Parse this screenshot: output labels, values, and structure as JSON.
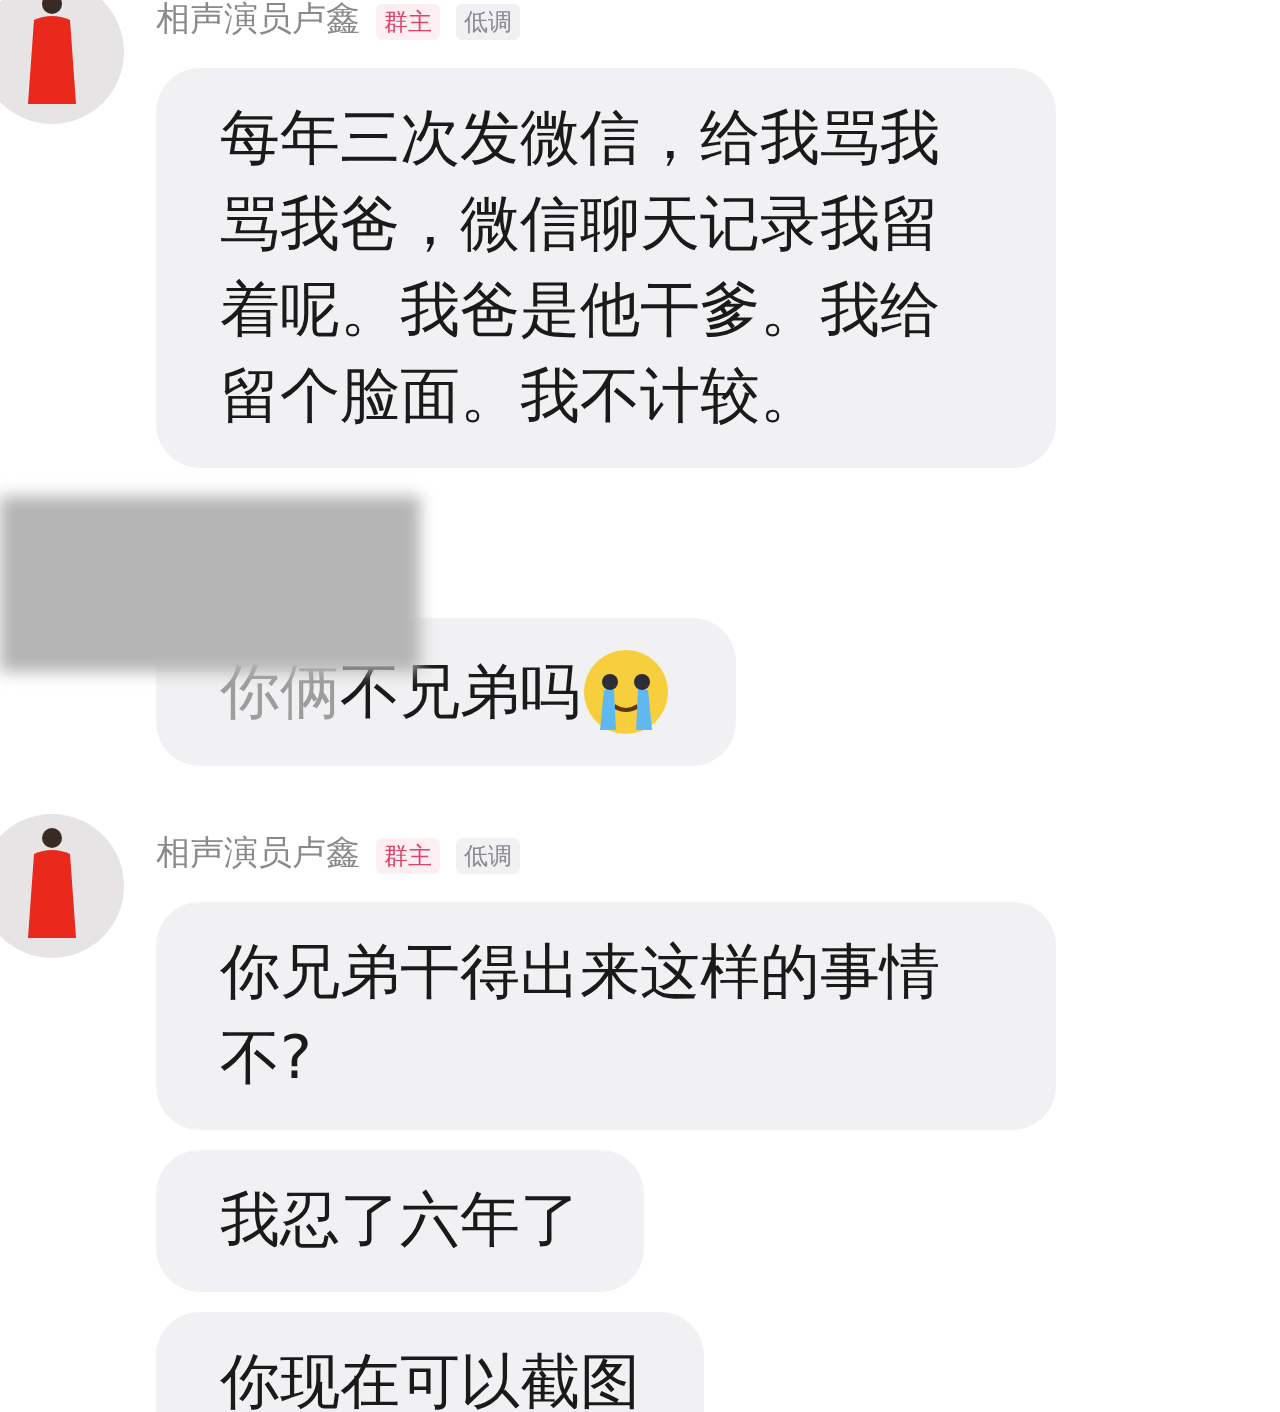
{
  "groups": [
    {
      "sender": {
        "name": "相声演员卢鑫",
        "badges": [
          {
            "label": "群主",
            "kind": "owner"
          },
          {
            "label": "低调",
            "kind": "title"
          }
        ]
      },
      "bubbles": [
        {
          "text": "每年三次发微信，给我骂我骂我爸，微信聊天记录我留着呢。我爸是他干爹。我给留个脸面。我不计较。"
        }
      ]
    },
    {
      "redacted": true,
      "bubbles": [
        {
          "faded": "你俩",
          "text": "不兄弟吗",
          "emoji": true
        }
      ]
    },
    {
      "sender": {
        "name": "相声演员卢鑫",
        "badges": [
          {
            "label": "群主",
            "kind": "owner"
          },
          {
            "label": "低调",
            "kind": "title"
          }
        ]
      },
      "bubbles": [
        {
          "text": "你兄弟干得出来这样的事情不?"
        },
        {
          "text": "我忍了六年了"
        },
        {
          "text": "你现在可以截图"
        }
      ]
    }
  ]
}
